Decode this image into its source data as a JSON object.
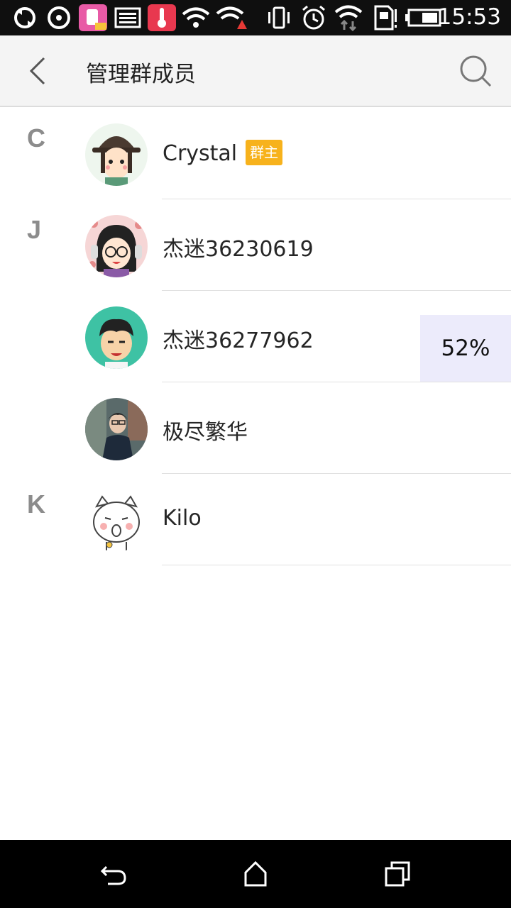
{
  "status_bar": {
    "time": "15:53",
    "icons": [
      "sync-icon",
      "loading-icon",
      "app-notification-icon",
      "image-icon",
      "thermometer-icon",
      "wifi-icon",
      "wifi-warning-icon",
      "vibrate-icon",
      "alarm-icon",
      "wifi-data-icon",
      "sim-icon",
      "battery-icon"
    ]
  },
  "header": {
    "title": "管理群成员",
    "back_icon": "back-arrow-icon",
    "search_icon": "search-icon"
  },
  "members": [
    {
      "letter": "C",
      "name": "Crystal",
      "badge": "群主",
      "avatar": "avatar-hat-girl"
    },
    {
      "letter": "J",
      "name": "杰迷36230619",
      "badge": "",
      "avatar": "avatar-headphone-girl"
    },
    {
      "letter": "",
      "name": "杰迷36277962",
      "badge": "",
      "avatar": "avatar-cartoon-boy"
    },
    {
      "letter": "",
      "name": "极尽繁华",
      "badge": "",
      "avatar": "avatar-photo-man"
    },
    {
      "letter": "K",
      "name": "Kilo",
      "badge": "",
      "avatar": "avatar-cartoon-cat"
    }
  ],
  "overlay": {
    "percent": "52%"
  },
  "nav_bar": {
    "icons": [
      "back-icon",
      "home-icon",
      "recents-icon"
    ]
  },
  "colors": {
    "badge": "#f7b21c",
    "letter": "#8c8c8c",
    "header_bg": "#f4f4f4"
  }
}
